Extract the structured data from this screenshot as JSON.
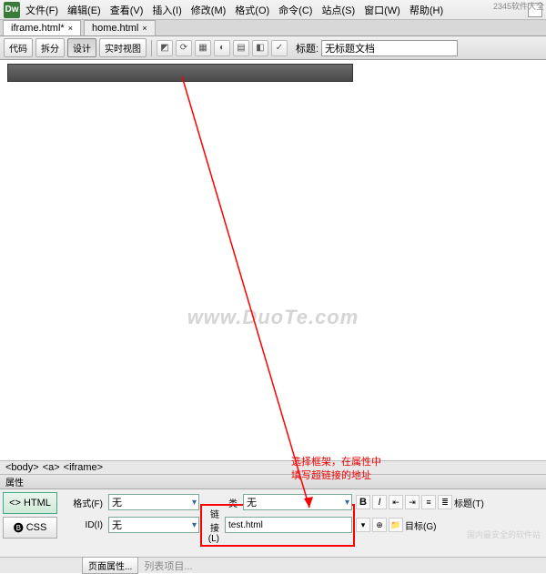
{
  "menu": {
    "items": [
      "文件(F)",
      "编辑(E)",
      "查看(V)",
      "插入(I)",
      "修改(M)",
      "格式(O)",
      "命令(C)",
      "站点(S)",
      "窗口(W)",
      "帮助(H)"
    ]
  },
  "tabs": [
    {
      "label": "iframe.html*"
    },
    {
      "label": "home.html"
    }
  ],
  "toolbar": {
    "code": "代码",
    "split": "拆分",
    "design": "设计",
    "live": "实时视图",
    "title_label": "标题:",
    "title_value": "无标题文档"
  },
  "watermark": "www.DuoTe.com",
  "annotation": {
    "line1": "选择框架，在属性中",
    "line2": "填写超链接的地址"
  },
  "tagselector": [
    "<body>",
    "<a>",
    "<iframe>"
  ],
  "panel": {
    "title": "属性"
  },
  "props": {
    "mode_html": "HTML",
    "mode_css": "CSS",
    "format_label": "格式(F)",
    "format_value": "无",
    "class_label": "类",
    "class_value": "无",
    "id_label": "ID(I)",
    "id_value": "无",
    "link_label": "链接(L)",
    "link_value": "test.html",
    "title2_label": "标题(T)",
    "target_label": "目标(G)"
  },
  "status": {
    "page_props": "页面属性...",
    "list_item": "列表项目..."
  },
  "badge": "2345软件大全",
  "footer": "国内最安全的软件站"
}
